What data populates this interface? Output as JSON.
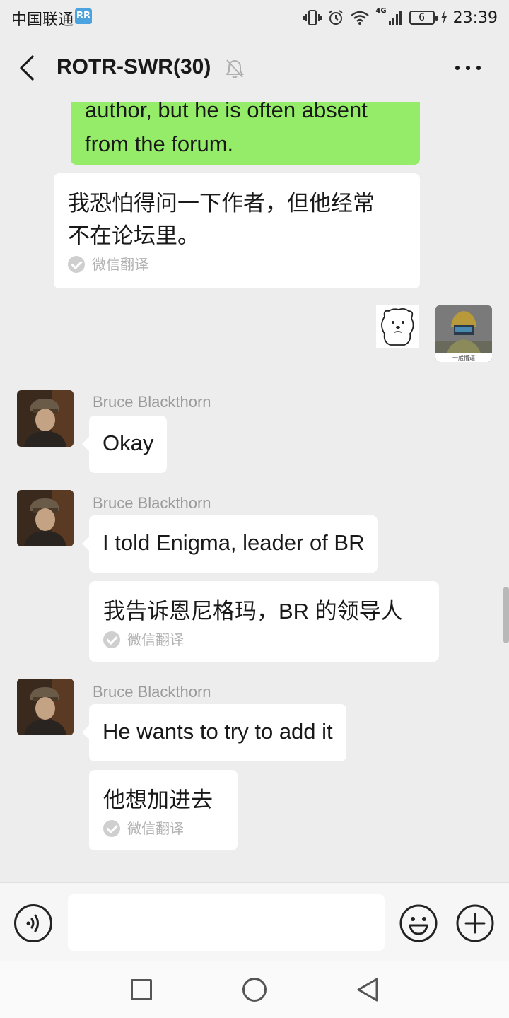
{
  "status_bar": {
    "carrier": "中国联通",
    "carrier_badge": "RR",
    "network": "4G",
    "battery": "6",
    "time": "23:39"
  },
  "header": {
    "title": "ROTR-SWR(30)",
    "back_icon": "chevron-left-icon",
    "mute_icon": "bell-off-icon",
    "more_icon": "more-dots-icon"
  },
  "messages": {
    "m1_partial": "author, but he is often absent",
    "m1_end": "from the forum.",
    "m1_translation_line1": "我恐怕得问一下作者，但他经常",
    "m1_translation_line2": "不在论坛里。",
    "translate_label": "微信翻译",
    "m2_sender": "Bruce Blackthorn",
    "m2_text": "Okay",
    "m3_sender": "Bruce Blackthorn",
    "m3_text": "I told Enigma, leader of BR",
    "m3_translation": "我告诉恩尼格玛，BR 的领导人",
    "m4_sender": "Bruce Blackthorn",
    "m4_text": "He wants to try to add it",
    "m4_translation": "他想加进去",
    "self_avatar_caption": "一般懵逼"
  },
  "colors": {
    "background": "#ededed",
    "self_bubble": "#95ec69",
    "other_bubble": "#ffffff",
    "sender_name": "#9a9a9a"
  },
  "input_bar": {
    "voice_icon": "voice-icon",
    "emoji_icon": "emoji-icon",
    "plus_icon": "plus-icon"
  },
  "nav_bar": {
    "recents_icon": "square-icon",
    "home_icon": "circle-icon",
    "back_icon": "triangle-back-icon"
  }
}
